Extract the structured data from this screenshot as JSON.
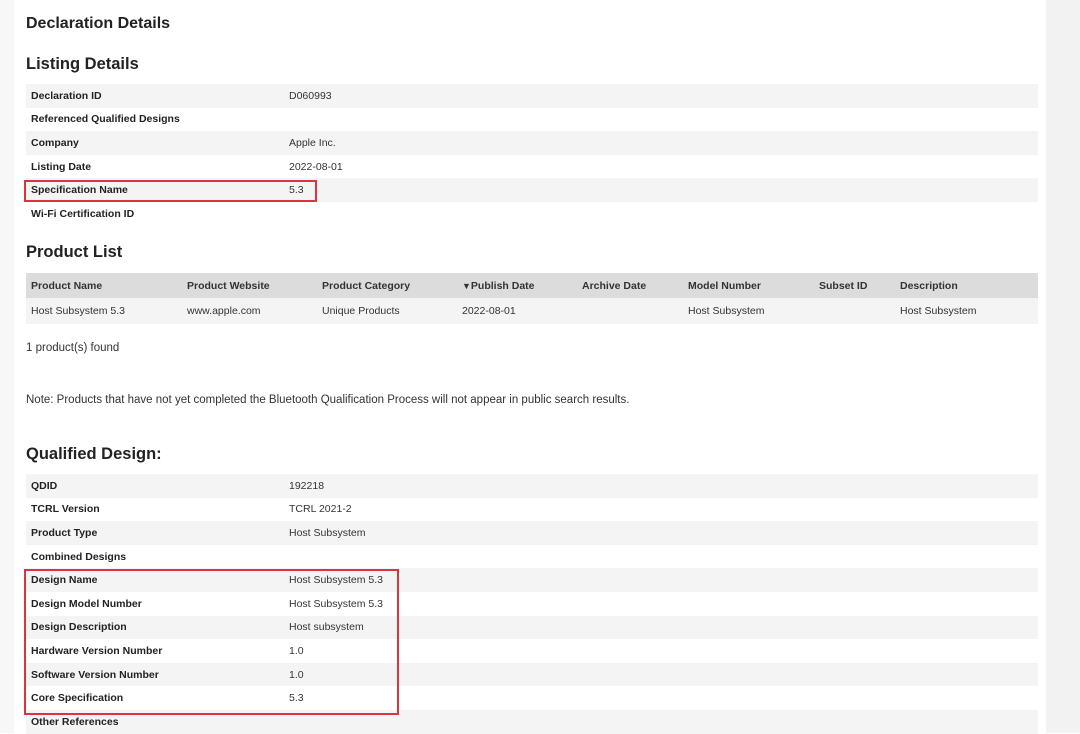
{
  "page_title": "Declaration Details",
  "listing": {
    "heading": "Listing Details",
    "rows": [
      {
        "label": "Declaration ID",
        "value": "D060993"
      },
      {
        "label": "Referenced Qualified Designs",
        "value": ""
      },
      {
        "label": "Company",
        "value": "Apple Inc."
      },
      {
        "label": "Listing Date",
        "value": "2022-08-01"
      },
      {
        "label": "Specification Name",
        "value": "5.3"
      },
      {
        "label": "Wi-Fi Certification ID",
        "value": ""
      }
    ]
  },
  "product_list": {
    "heading": "Product List",
    "sort_indicator": "▼",
    "columns": [
      "Product Name",
      "Product Website",
      "Product Category",
      "Publish Date",
      "Archive Date",
      "Model Number",
      "Subset ID",
      "Description"
    ],
    "rows": [
      [
        "Host Subsystem 5.3",
        "www.apple.com",
        "Unique Products",
        "2022-08-01",
        "",
        "Host Subsystem",
        "",
        "Host Subsystem"
      ]
    ],
    "found_text": "1 product(s) found"
  },
  "note": "Note: Products that have not yet completed the Bluetooth Qualification Process will not appear in public search results.",
  "qualified_design": {
    "heading": "Qualified Design:",
    "rows": [
      {
        "label": "QDID",
        "value": "192218"
      },
      {
        "label": "TCRL Version",
        "value": "TCRL 2021-2"
      },
      {
        "label": "Product Type",
        "value": "Host Subsystem"
      },
      {
        "label": "Combined Designs",
        "value": ""
      },
      {
        "label": "Design Name",
        "value": "Host Subsystem 5.3"
      },
      {
        "label": "Design Model Number",
        "value": "Host Subsystem 5.3"
      },
      {
        "label": "Design Description",
        "value": "Host subsystem"
      },
      {
        "label": "Hardware Version Number",
        "value": "1.0"
      },
      {
        "label": "Software Version Number",
        "value": "1.0"
      },
      {
        "label": "Core Specification",
        "value": "5.3"
      },
      {
        "label": "Other References",
        "value": ""
      }
    ]
  },
  "highlight_color": "#d9343f"
}
